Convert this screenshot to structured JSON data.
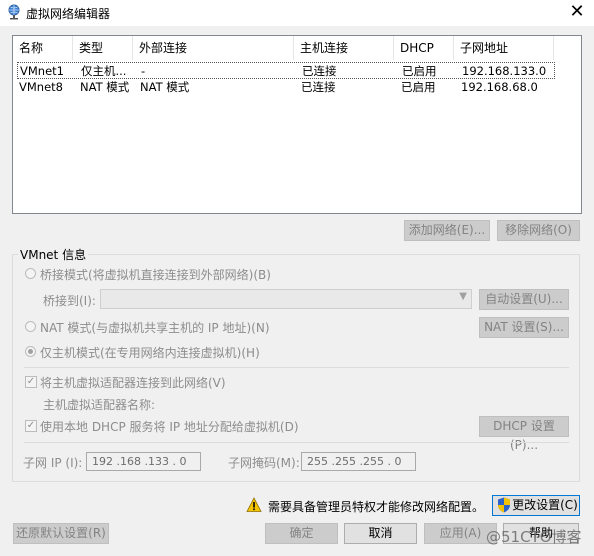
{
  "window": {
    "title": "虚拟网络编辑器",
    "close_glyph": "✕"
  },
  "network_table": {
    "columns": [
      "名称",
      "类型",
      "外部连接",
      "主机连接",
      "DHCP",
      "子网地址"
    ],
    "rows": [
      {
        "name": "VMnet1",
        "type": "仅主机...",
        "external": "-",
        "host": "已连接",
        "dhcp": "已启用",
        "subnet": "192.168.133.0",
        "selected": true
      },
      {
        "name": "VMnet8",
        "type": "NAT 模式",
        "external": "NAT 模式",
        "host": "已连接",
        "dhcp": "已启用",
        "subnet": "192.168.68.0",
        "selected": false
      }
    ]
  },
  "list_buttons": {
    "add": "添加网络(E)...",
    "remove": "移除网络(O)"
  },
  "vmnet_info": {
    "title": "VMnet 信息",
    "bridged_label": "桥接模式(将虚拟机直接连接到外部网络)(B)",
    "bridged_to_label": "桥接到(I):",
    "bridged_to_value": "",
    "auto_settings": "自动设置(U)...",
    "nat_label": "NAT 模式(与虚拟机共享主机的 IP 地址)(N)",
    "nat_settings": "NAT 设置(S)...",
    "hostonly_label": "仅主机模式(在专用网络内连接虚拟机)(H)",
    "selected_mode": "hostonly",
    "connect_adapter_label": "将主机虚拟适配器连接到此网络(V)",
    "connect_adapter_checked": true,
    "adapter_name_label": "主机虚拟适配器名称:",
    "dhcp_label": "使用本地 DHCP 服务将 IP 地址分配给虚拟机(D)",
    "dhcp_checked": true,
    "dhcp_settings": "DHCP 设置(P)...",
    "subnet_ip_label": "子网 IP (I):",
    "subnet_ip": "192 .168 .133 . 0",
    "subnet_mask_label": "子网掩码(M):",
    "subnet_mask": "255 .255 .255 . 0"
  },
  "admin_notice": "需要具备管理员特权才能修改网络配置。",
  "change_settings": "更改设置(C)",
  "footer_buttons": {
    "restore": "还原默认设置(R)",
    "ok": "确定",
    "cancel": "取消",
    "apply": "应用(A)",
    "help": "帮助"
  },
  "watermark": "@51CTO博客",
  "colors": {
    "accent": "#0078d7",
    "disabled_text": "#838383",
    "warning": "#f5c400"
  }
}
